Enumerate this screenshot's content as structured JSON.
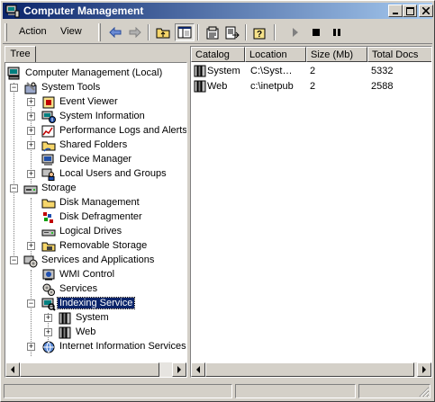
{
  "window": {
    "title": "Computer Management",
    "colors": {
      "title_start": "#0a246a",
      "title_end": "#a6caf0",
      "face": "#d4d0c8",
      "selection": "#0a246a"
    }
  },
  "caption_buttons": [
    "minimize-icon",
    "maximize-icon",
    "close-icon"
  ],
  "menu": {
    "action": "Action",
    "view": "View"
  },
  "toolbar": {
    "icons": [
      "back-arrow-icon",
      "forward-arrow-icon",
      "up-folder-icon",
      "show-hide-tree-icon",
      "properties-icon",
      "export-list-icon",
      "help-icon",
      "play-icon",
      "stop-icon",
      "pause-icon"
    ]
  },
  "tree": {
    "tab_label": "Tree",
    "items": [
      {
        "label": "Computer Management (Local)",
        "icon": "computer-icon"
      },
      {
        "label": "System Tools",
        "icon": "tools-icon"
      },
      {
        "label": "Event Viewer",
        "icon": "event-viewer-icon"
      },
      {
        "label": "System Information",
        "icon": "system-information-icon"
      },
      {
        "label": "Performance Logs and Alerts",
        "icon": "performance-icon"
      },
      {
        "label": "Shared Folders",
        "icon": "shared-folder-icon"
      },
      {
        "label": "Device Manager",
        "icon": "device-manager-icon"
      },
      {
        "label": "Local Users and Groups",
        "icon": "users-icon"
      },
      {
        "label": "Storage",
        "icon": "storage-icon"
      },
      {
        "label": "Disk Management",
        "icon": "disk-management-icon"
      },
      {
        "label": "Disk Defragmenter",
        "icon": "defragmenter-icon"
      },
      {
        "label": "Logical Drives",
        "icon": "drive-icon"
      },
      {
        "label": "Removable Storage",
        "icon": "removable-storage-icon"
      },
      {
        "label": "Services and Applications",
        "icon": "services-apps-icon"
      },
      {
        "label": "WMI Control",
        "icon": "wmi-icon"
      },
      {
        "label": "Services",
        "icon": "gears-icon"
      },
      {
        "label": "Indexing Service",
        "icon": "indexing-service-icon"
      },
      {
        "label": "System",
        "icon": "catalog-icon"
      },
      {
        "label": "Web",
        "icon": "catalog-icon"
      },
      {
        "label": "Internet Information Services",
        "icon": "iis-icon"
      }
    ]
  },
  "detail": {
    "columns": [
      "Catalog",
      "Location",
      "Size (Mb)",
      "Total Docs"
    ],
    "rows": [
      {
        "catalog": "System",
        "location": "C:\\Syst…",
        "size": "2",
        "docs": "5332"
      },
      {
        "catalog": "Web",
        "location": "c:\\inetpub",
        "size": "2",
        "docs": "2588"
      }
    ]
  }
}
